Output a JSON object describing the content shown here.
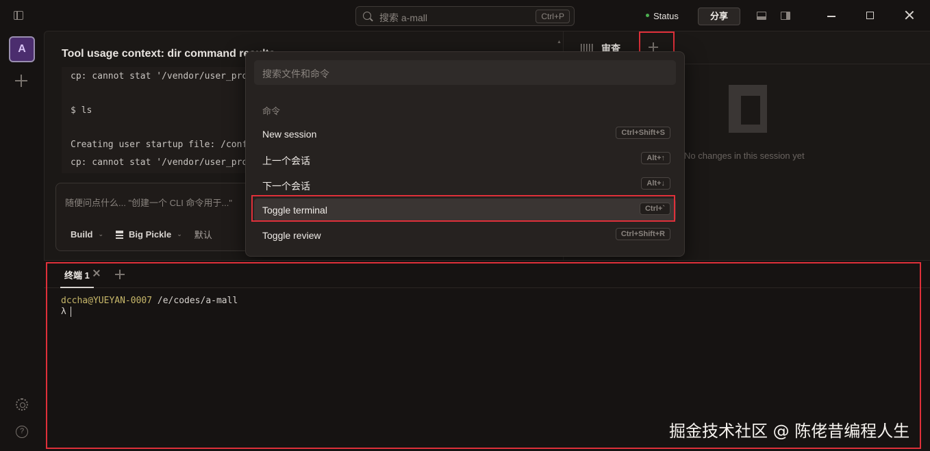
{
  "titlebar": {
    "search_placeholder": "搜索 a-mall",
    "search_shortcut": "Ctrl+P",
    "status_label": "Status",
    "status_color": "#4caf50",
    "share_label": "分享"
  },
  "rail": {
    "avatar_letter": "A",
    "help_symbol": "?"
  },
  "session": {
    "title": "Tool usage context: dir command results",
    "output_lines": [
      "cp: cannot stat '/vendor/user_pro",
      "$ ls",
      "Creating user startup file: /conf",
      "cp: cannot stat '/vendor/user_pro"
    ],
    "prompt_placeholder": "随便问点什么... \"创建一个 CLI 命令用于...\"",
    "agent_label": "Build",
    "model_label": "Big Pickle",
    "variant_label": "默认"
  },
  "review": {
    "tab_label": "审查",
    "empty_message": "No changes in this session yet"
  },
  "palette": {
    "search_placeholder": "搜索文件和命令",
    "section_label": "命令",
    "commands": [
      {
        "label": "New session",
        "shortcut": "Ctrl+Shift+S"
      },
      {
        "label": "上一个会话",
        "shortcut": "Alt+↑"
      },
      {
        "label": "下一个会话",
        "shortcut": "Alt+↓"
      },
      {
        "label": "Toggle terminal",
        "shortcut": "Ctrl+`"
      },
      {
        "label": "Toggle review",
        "shortcut": "Ctrl+Shift+R"
      }
    ]
  },
  "terminal": {
    "tab_label": "终端 1",
    "user_host": "dccha@YUEYAN-0007",
    "cwd": " /e/codes/a-mall",
    "prompt_symbol": "λ"
  },
  "watermark": "掘金技术社区 @ 陈佬昔编程人生",
  "colors": {
    "highlight": "#e0303a",
    "accent_avatar": "#4b2d6e"
  }
}
